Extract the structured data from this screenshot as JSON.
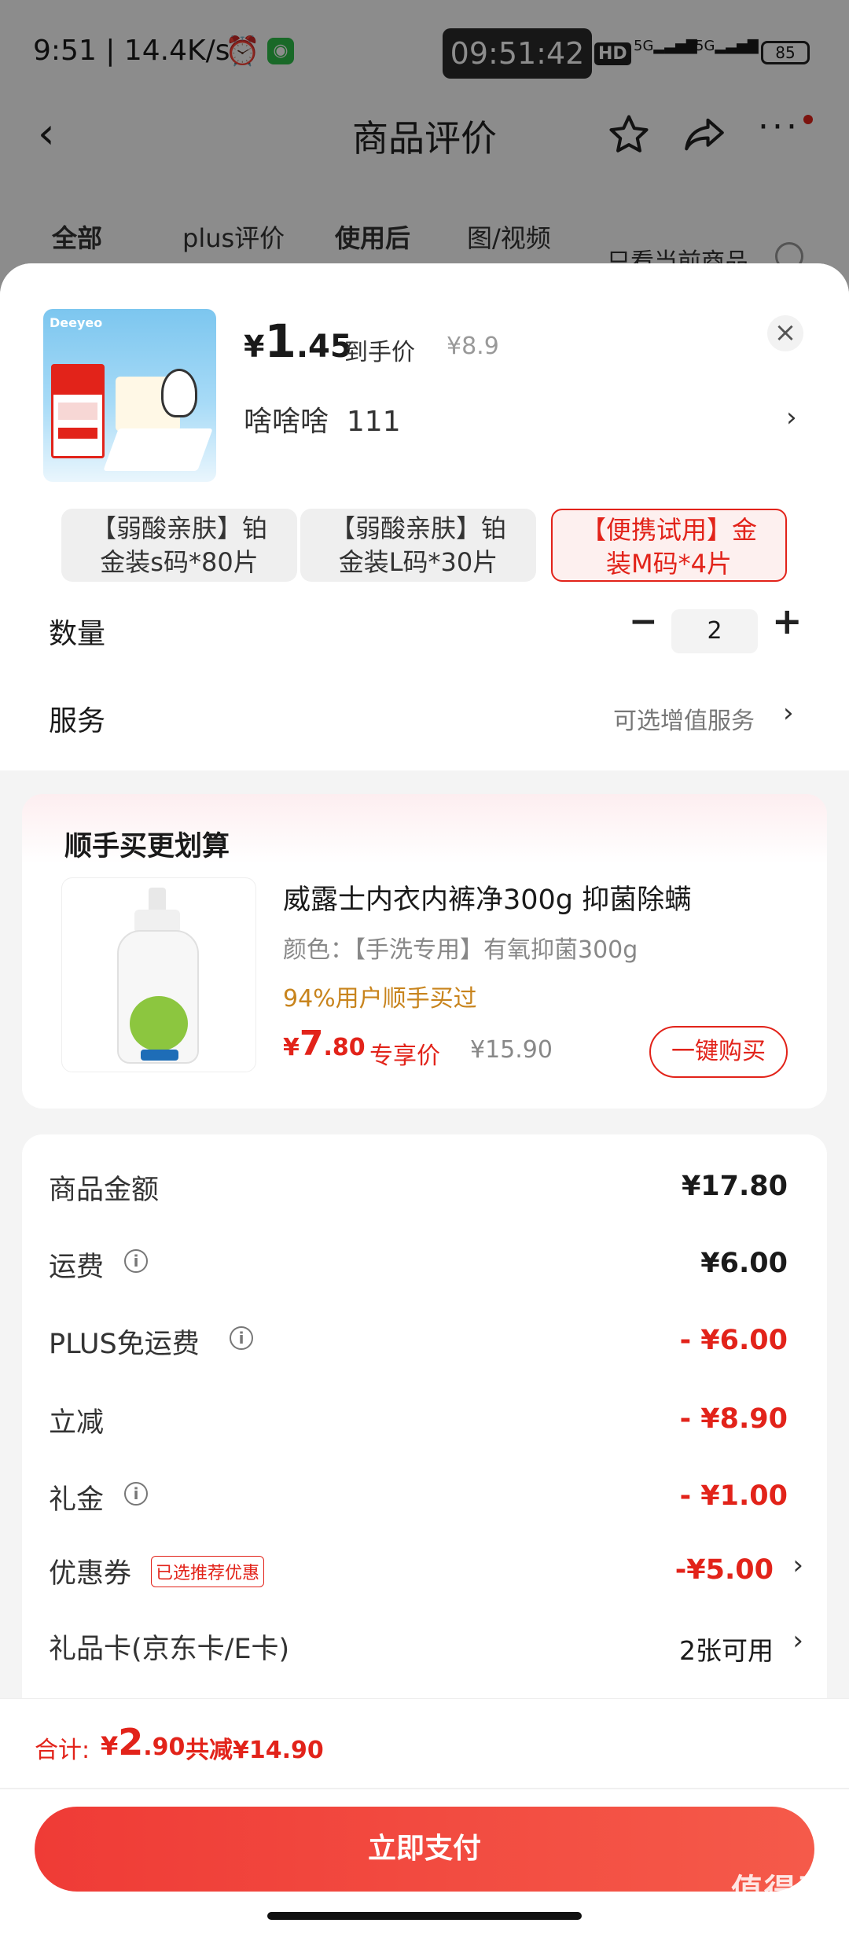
{
  "status_bar": {
    "time": "9:51",
    "speed": "14.4K/s",
    "clock": "09:51:42",
    "hd": "HD",
    "net1": "5G",
    "net2": "5G",
    "battery": "85"
  },
  "nav": {
    "title": "商品评价"
  },
  "tabs": [
    "全部",
    "plus评价",
    "使用后",
    "图/视频"
  ],
  "filter": {
    "label": "只看当前商品"
  },
  "product": {
    "brand": "Deeyeo",
    "price_symbol": "¥",
    "price_int": "1",
    "price_dec": ".45",
    "price_suffix": "到手价",
    "original_price": "¥8.9",
    "variant": "啥啥啥",
    "variant_count": "111"
  },
  "specs": [
    {
      "label": "【弱酸亲肤】铂金装s码*80片",
      "line1": "【弱酸亲肤】铂",
      "line2": "金装s码*80片",
      "selected": false
    },
    {
      "label": "【弱酸亲肤】铂金装L码*30片",
      "line1": "【弱酸亲肤】铂",
      "line2": "金装L码*30片",
      "selected": false
    },
    {
      "label": "【便携试用】金装M码*4片",
      "line1": "【便携试用】金",
      "line2": "装M码*4片",
      "selected": true
    }
  ],
  "quantity": {
    "label": "数量",
    "value": "2",
    "minus": "−",
    "plus": "+"
  },
  "service": {
    "label": "服务",
    "value": "可选增值服务"
  },
  "upsell": {
    "title": "顺手买更划算",
    "name": "威露士内衣内裤净300g 抑菌除螨",
    "spec": "颜色：【手洗专用】有氧抑菌300g",
    "social": "94%用户顺手买过",
    "price_symbol": "¥",
    "price_int": "7",
    "price_dec": ".80",
    "price_tag": "专享价",
    "original": "¥15.90",
    "button": "一键购买"
  },
  "summary": [
    {
      "label": "商品金额",
      "value": "¥17.80",
      "info": false,
      "red": false
    },
    {
      "label": "运费",
      "value": "¥6.00",
      "info": true,
      "red": false
    },
    {
      "label": "PLUS免运费",
      "value": "- ¥6.00",
      "info": true,
      "red": true
    },
    {
      "label": "立减",
      "value": "- ¥8.90",
      "info": false,
      "red": true
    },
    {
      "label": "礼金",
      "value": "- ¥1.00",
      "info": true,
      "red": true
    }
  ],
  "coupon": {
    "label": "优惠券",
    "badge": "已选推荐优惠",
    "value": "-¥5.00"
  },
  "giftcard": {
    "label": "礼品卡(京东卡/E卡)",
    "value": "2张可用"
  },
  "footer": {
    "total_label": "合计:",
    "symbol": "¥",
    "total_int": "2",
    "total_dec": ".90",
    "reduced": "共减¥14.90",
    "pay": "立即支付"
  },
  "watermark": "值得买",
  "watermark_url": "zhizhizhi.com",
  "colors": {
    "accent": "#e2231a",
    "pay_start": "#ef3b36",
    "pay_end": "#f55a4a",
    "gold": "#c8841d"
  }
}
